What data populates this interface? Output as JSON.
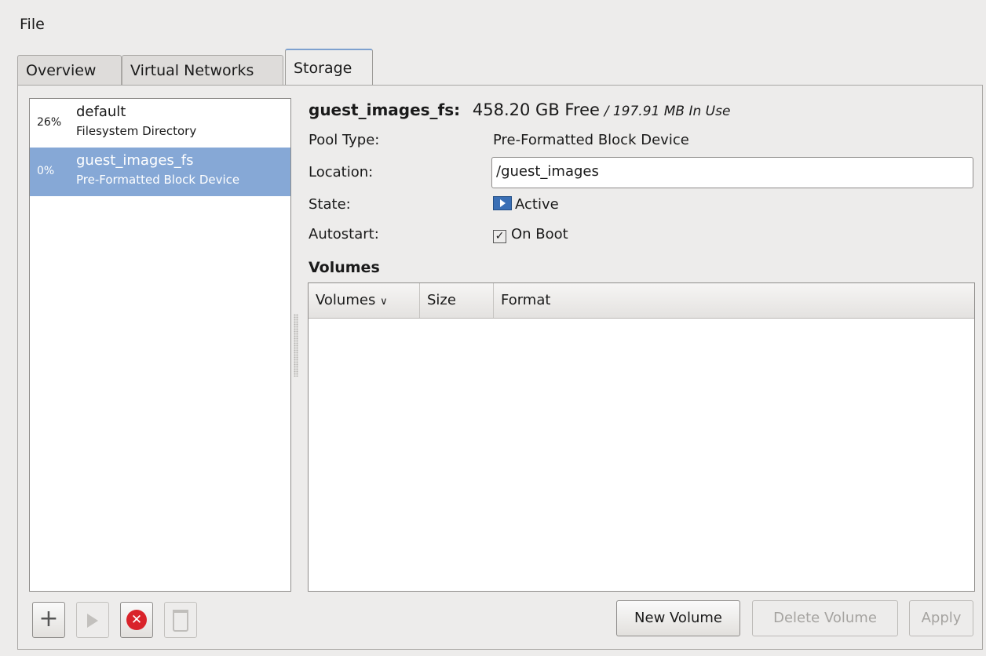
{
  "menubar": {
    "file_label": "File"
  },
  "tabs": [
    {
      "label": "Overview"
    },
    {
      "label": "Virtual Networks"
    },
    {
      "label": "Storage"
    }
  ],
  "pools": [
    {
      "usage": "26%",
      "name": "default",
      "type": "Filesystem Directory"
    },
    {
      "usage": "0%",
      "name": "guest_images_fs",
      "type": "Pre-Formatted Block Device"
    }
  ],
  "detail": {
    "pool_name": "guest_images_fs:",
    "free": "458.20 GB Free",
    "in_use": "/ 197.91 MB In Use",
    "pool_type_label": "Pool Type:",
    "pool_type_value": "Pre-Formatted Block Device",
    "location_label": "Location:",
    "location_value": "/guest_images",
    "state_label": "State:",
    "state_value": "Active",
    "autostart_label": "Autostart:",
    "autostart_value": "On Boot",
    "autostart_checked": true
  },
  "volumes": {
    "heading": "Volumes",
    "columns": [
      "Volumes",
      "Size",
      "Format"
    ],
    "rows": []
  },
  "buttons": {
    "new_volume": "New Volume",
    "delete_volume": "Delete Volume",
    "apply": "Apply"
  },
  "icons": {
    "add_pool": "plus-icon",
    "start_pool": "play-icon",
    "stop_pool": "stop-icon",
    "delete_pool": "trash-icon",
    "state": "active-state-icon"
  }
}
